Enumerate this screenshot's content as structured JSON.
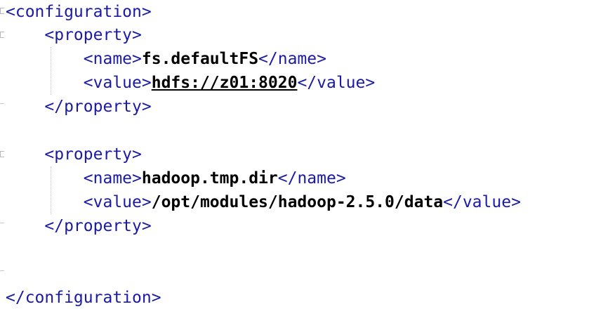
{
  "editor": {
    "lines": {
      "config_open": "<configuration>",
      "prop1_open": "<property>",
      "prop1_name_open": "<name>",
      "prop1_name_value": "fs.defaultFS",
      "prop1_name_close": "</name>",
      "prop1_value_open": "<value>",
      "prop1_value_value": "hdfs://z01:8020",
      "prop1_value_close": "</value>",
      "prop1_close": "</property>",
      "prop2_open": "<property>",
      "prop2_name_open": "<name>",
      "prop2_name_value": "hadoop.tmp.dir",
      "prop2_name_close": "</name>",
      "prop2_value_open": "<value>",
      "prop2_value_value": "/opt/modules/hadoop-2.5.0/data",
      "prop2_value_close": "</value>",
      "prop2_close": "</property>",
      "config_close": "</configuration>"
    },
    "colors": {
      "tag": "#1a1aa6",
      "value": "#000000",
      "background": "#ffffff"
    }
  }
}
